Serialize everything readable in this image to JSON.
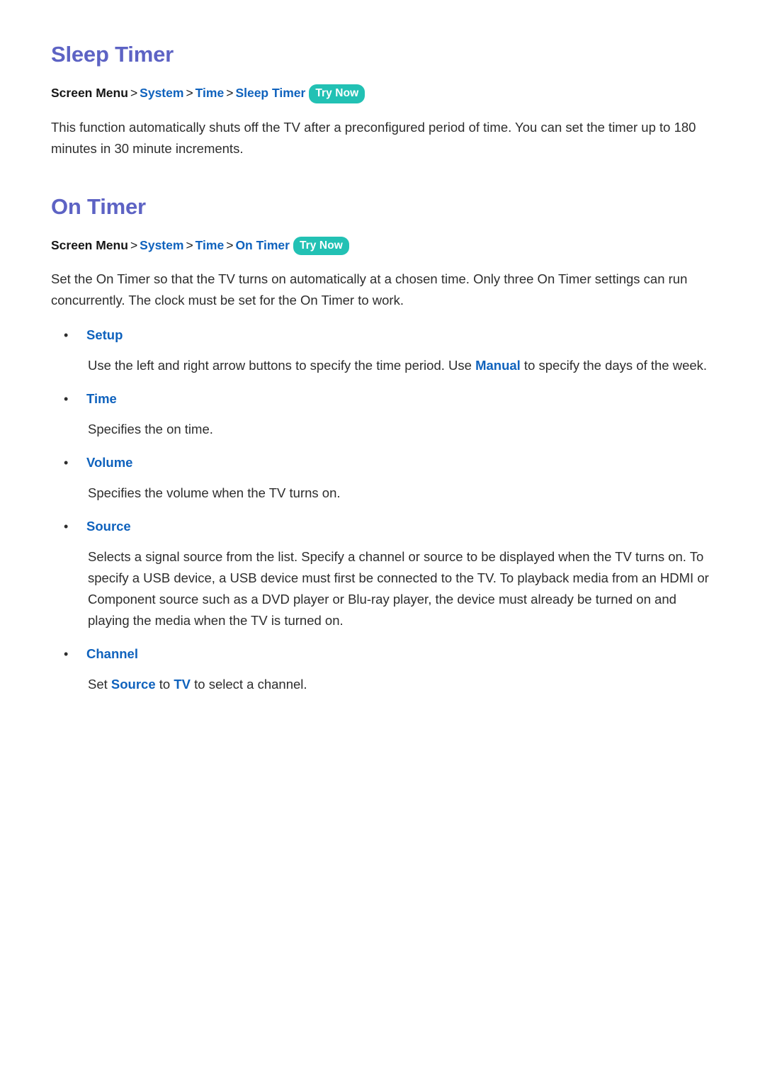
{
  "document": {
    "background_color": "#ffffff",
    "heading_color": "#5d63c4",
    "link_color": "#0f62bd",
    "badge_color": "#22c1b4",
    "body_color": "#2d2d2d"
  },
  "sections": [
    {
      "title": "Sleep Timer",
      "breadcrumb": {
        "root": "Screen Menu",
        "sep": ">",
        "links": [
          "System",
          "Time",
          "Sleep Timer"
        ],
        "badge": "Try Now"
      },
      "paragraph": "This function automatically shuts off the TV after a preconfigured period of time. You can set the timer up to 180 minutes in 30 minute increments."
    },
    {
      "title": "On Timer",
      "breadcrumb": {
        "root": "Screen Menu",
        "sep": ">",
        "links": [
          "System",
          "Time",
          "On Timer"
        ],
        "badge": "Try Now"
      },
      "paragraph": "Set the On Timer so that the TV turns on automatically at a chosen time. Only three On Timer settings can run concurrently. The clock must be set for the On Timer to work.",
      "bullets": [
        {
          "label": "Setup",
          "text_before": "Use the left and right arrow buttons to specify the time period. Use ",
          "inline_key": "Manual",
          "text_after": " to specify the days of the week."
        },
        {
          "label": "Time",
          "text": "Specifies the on time."
        },
        {
          "label": "Volume",
          "text": "Specifies the volume when the TV turns on."
        },
        {
          "label": "Source",
          "text": "Selects a signal source from the list. Specify a channel or source to be displayed when the TV turns on. To specify a USB device, a USB device must first be connected to the TV. To playback media from an HDMI or Component source such as a DVD player or Blu-ray player, the device must already be turned on and playing the media when the TV is turned on."
        },
        {
          "label": "Channel",
          "text_before": "Set ",
          "inline_key": "Source",
          "text_mid": " to ",
          "inline_key2": "TV",
          "text_after": " to select a channel."
        }
      ]
    }
  ]
}
